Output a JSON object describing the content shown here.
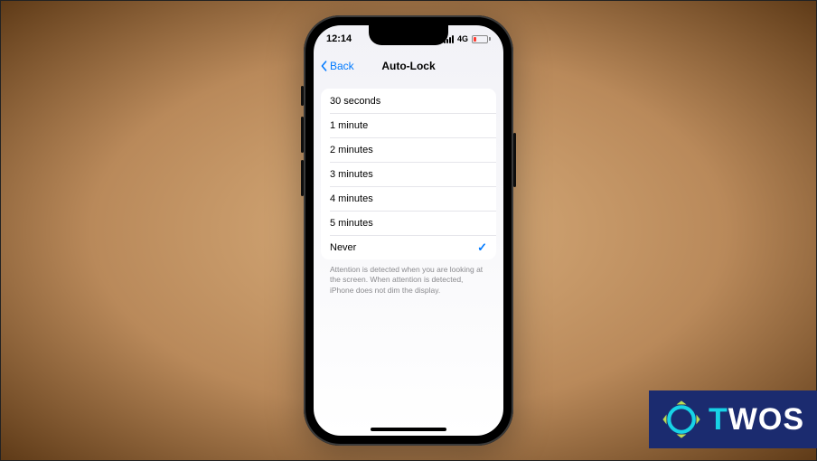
{
  "status": {
    "time": "12:14",
    "network_label": "4G"
  },
  "nav": {
    "back_label": "Back",
    "title": "Auto-Lock"
  },
  "autolock": {
    "options": [
      {
        "label": "30 seconds",
        "selected": false
      },
      {
        "label": "1 minute",
        "selected": false
      },
      {
        "label": "2 minutes",
        "selected": false
      },
      {
        "label": "3 minutes",
        "selected": false
      },
      {
        "label": "4 minutes",
        "selected": false
      },
      {
        "label": "5 minutes",
        "selected": false
      },
      {
        "label": "Never",
        "selected": true
      }
    ],
    "footer": "Attention is detected when you are looking at the screen. When attention is detected, iPhone does not dim the display."
  },
  "badge": {
    "text": "TWOS"
  }
}
